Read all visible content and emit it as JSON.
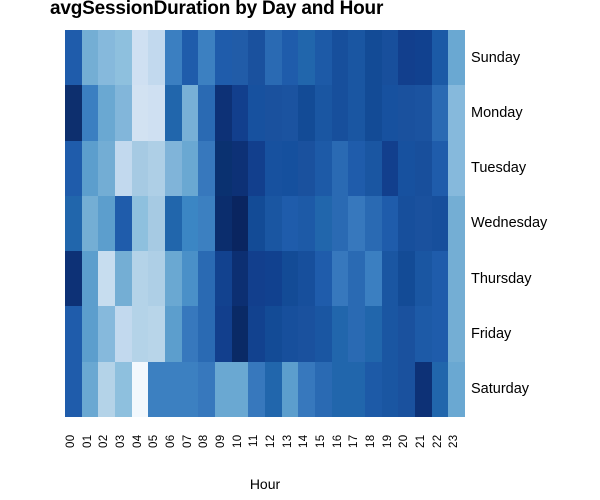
{
  "chart_data": {
    "type": "heatmap",
    "title": "avgSessionDuration by Day and Hour",
    "xlabel": "Hour",
    "ylabel": "",
    "grid": false,
    "legend": "none",
    "x_categories": [
      "00",
      "01",
      "02",
      "03",
      "04",
      "05",
      "06",
      "07",
      "08",
      "09",
      "10",
      "11",
      "12",
      "13",
      "14",
      "15",
      "16",
      "17",
      "18",
      "19",
      "20",
      "21",
      "22",
      "23"
    ],
    "y_categories": [
      "Sunday",
      "Monday",
      "Tuesday",
      "Wednesday",
      "Thursday",
      "Friday",
      "Saturday"
    ],
    "colorscale_low": "#f7fbff",
    "colorscale_high": "#08306b",
    "rows": [
      {
        "day": "Sunday",
        "colors": [
          "#1f5cab",
          "#74aed4",
          "#86b9dc",
          "#8ec0de",
          "#cfe0f2",
          "#c2d9ee",
          "#3b7fc1",
          "#1f5cab",
          "#3c80c1",
          "#1f5cab",
          "#215ca8",
          "#1a519e",
          "#2a6ab3",
          "#1f5cab",
          "#2166ac",
          "#1d5aa7",
          "#174f9c",
          "#1a56a2",
          "#134b96",
          "#184f9c",
          "#123f8d",
          "#11418f",
          "#1b5aa6",
          "#6aa8d2"
        ]
      },
      {
        "day": "Monday",
        "colors": [
          "#0d2f6e",
          "#3b7fc1",
          "#6aa8d2",
          "#82b6da",
          "#d2e2f2",
          "#cfe0f2",
          "#2166ac",
          "#78b0d6",
          "#2a6ab3",
          "#0d3176",
          "#123f8d",
          "#17519f",
          "#1a519e",
          "#1b53a0",
          "#134b96",
          "#1a56a2",
          "#174f9c",
          "#1a56a2",
          "#134b96",
          "#17519f",
          "#1a519e",
          "#1b53a0",
          "#2a6ab3",
          "#86b9dc"
        ]
      },
      {
        "day": "Tuesday",
        "colors": [
          "#1f5cab",
          "#5c9ecd",
          "#73adD4",
          "#c2d9ee",
          "#a6cae3",
          "#aecfe6",
          "#80b4d9",
          "#6aa8d2",
          "#3778bd",
          "#0a3170",
          "#0d3176",
          "#123f8d",
          "#17519f",
          "#15509e",
          "#1a519e",
          "#1d5aa7",
          "#2a6ab3",
          "#1f5cab",
          "#1a56a2",
          "#123f8d",
          "#17519f",
          "#184f9c",
          "#1f5cab",
          "#86b9dc"
        ]
      },
      {
        "day": "Wednesday",
        "colors": [
          "#2166ac",
          "#74aed4",
          "#5c9ecd",
          "#1f5cab",
          "#8ec0de",
          "#a6cae3",
          "#2166ac",
          "#3b86c4",
          "#3c80c1",
          "#0b2d6d",
          "#0a2560",
          "#134b96",
          "#1a56a2",
          "#1f5cab",
          "#1d5aa7",
          "#2166ac",
          "#2a6ab3",
          "#3778bd",
          "#2a6ab3",
          "#1f5cab",
          "#174f9c",
          "#1a519e",
          "#174f9c",
          "#74aed4"
        ]
      },
      {
        "day": "Thursday",
        "colors": [
          "#0d3176",
          "#5c9ecd",
          "#c7ddef",
          "#74aed4",
          "#b4d3e8",
          "#aecfe6",
          "#6aa8d2",
          "#4a90c8",
          "#2a6ab3",
          "#12428f",
          "#0c2f72",
          "#123f8d",
          "#11418f",
          "#134b96",
          "#174f9c",
          "#1f5cab",
          "#3778bd",
          "#2a6ab3",
          "#3b7fc1",
          "#1a56a2",
          "#134b96",
          "#1a56a2",
          "#1f5cab",
          "#74aed4"
        ]
      },
      {
        "day": "Friday",
        "colors": [
          "#1f5cab",
          "#5c9ecd",
          "#86b9dc",
          "#c2d9ee",
          "#b4d3e8",
          "#b8d5e9",
          "#5c9ecd",
          "#3778bd",
          "#2a6ab3",
          "#123f8d",
          "#0a2a66",
          "#12428f",
          "#134b96",
          "#174f9c",
          "#1a519e",
          "#1a56a2",
          "#2166ac",
          "#2a6ab3",
          "#2166ac",
          "#1a56a2",
          "#1a519e",
          "#1d5aa7",
          "#1f5cab",
          "#74aed4"
        ]
      },
      {
        "day": "Saturday",
        "colors": [
          "#1f5cab",
          "#6aa8d2",
          "#b4d3e8",
          "#8ec0de",
          "#f2f8fd",
          "#3c80c1",
          "#3c80c1",
          "#3c80c1",
          "#3778bd",
          "#6aa8d2",
          "#6aa8d2",
          "#3778bd",
          "#2166ac",
          "#5c9ecd",
          "#3778bd",
          "#2a6ab3",
          "#2166ac",
          "#2166ac",
          "#1d5aa7",
          "#1a56a2",
          "#1a519e",
          "#0d3176",
          "#2166ac",
          "#6aa8d2"
        ]
      }
    ]
  }
}
